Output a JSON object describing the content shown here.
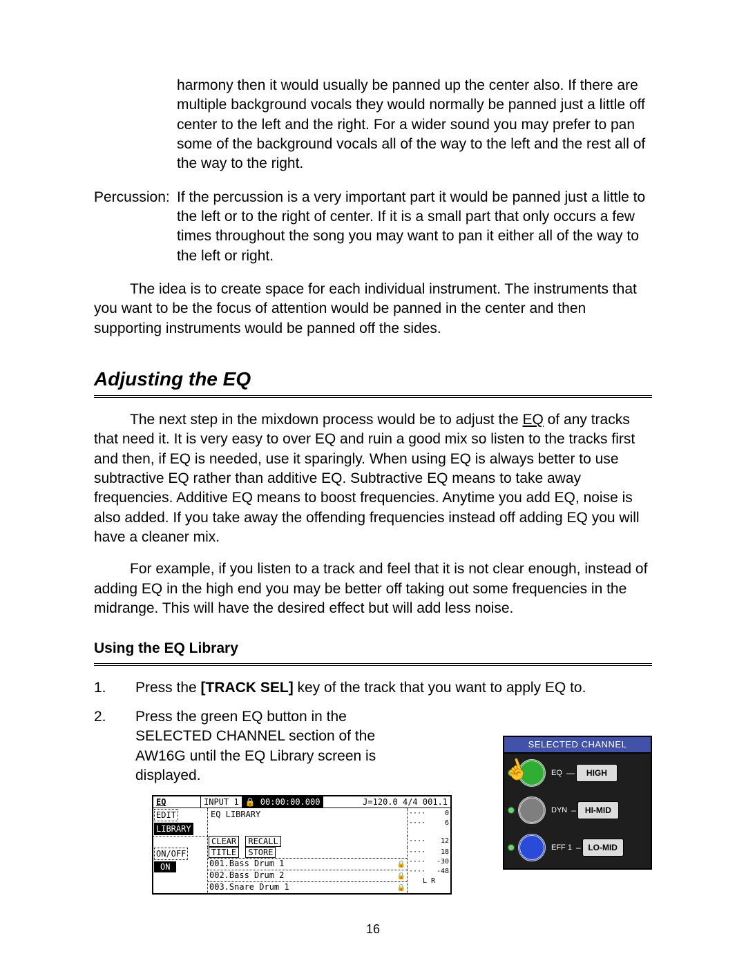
{
  "paragraphs": {
    "vocals_cont": "harmony then it would usually be panned up the center also.  If there are multiple background vocals they would normally be panned just a little off center to the left and the right.  For a wider sound you may prefer to pan some of the background vocals all of the way to the left and the rest all of the way to the right.",
    "percussion_label": "Percussion:",
    "percussion_body": "If the percussion is a very important part it would be panned just a little to the left or to the right of center.  If it is a small part that only occurs a few times throughout the song you may want to pan it either all of the way to the left or right.",
    "idea": "The idea is to create space for each individual instrument.  The instruments that you want to be the focus of attention would be panned in the center and then supporting instruments would be panned off the sides."
  },
  "section_title": "Adjusting the EQ",
  "eq_intro_before_link": "The next step in the mixdown process would be to adjust the ",
  "eq_link": "EQ",
  "eq_intro_after_link": " of any tracks that need it.  It is very easy to over EQ and ruin a good mix so listen to the tracks first and then, if EQ is needed, use it sparingly.  When using EQ is always better to use subtractive EQ rather than additive EQ.  Subtractive EQ means to take away frequencies.  Additive EQ means to boost frequencies. Anytime you add EQ, noise is also added.  If you take away the offending frequencies instead off adding EQ you will have a cleaner mix.",
  "eq_example": "For example, if you listen to a track and feel that it is not clear enough, instead of adding EQ in the high end you may be better off taking out some frequencies in the midrange.  This will have the desired effect but will add less noise.",
  "sub_title": "Using the EQ Library",
  "steps": {
    "s1_num": "1.",
    "s1_a": "Press the ",
    "s1_b": "[TRACK SEL]",
    "s1_c": " key of the track that you want to apply EQ to.",
    "s2_num": "2.",
    "s2": "Press the green EQ button in the SELECTED CHANNEL section of the AW16G until the EQ Library screen is displayed."
  },
  "lcd": {
    "eq": "EQ",
    "input": "INPUT  1",
    "time": "00:00:00.000",
    "tempo": "J=120.0 4/4 001.1",
    "edit": "EDIT",
    "library": "LIBRARY",
    "eq_library": "EQ LIBRARY",
    "clear": "CLEAR",
    "recall": "RECALL",
    "title": "TITLE",
    "store": "STORE",
    "onoff": "ON/OFF",
    "on": "ON",
    "list1": "001.Bass Drum 1",
    "list2": "002.Bass Drum 2",
    "list3": "003.Snare Drum 1",
    "m0": "0",
    "m6": "6",
    "m12": "12",
    "m18": "18",
    "m30": "-30",
    "m48": "-48",
    "lr": "L R"
  },
  "panel": {
    "title": "SELECTED CHANNEL",
    "eq": "EQ",
    "dyn": "DYN",
    "eff1": "EFF 1",
    "high": "HIGH",
    "himid": "HI-MID",
    "lomid": "LO-MID"
  },
  "page_number": "16"
}
